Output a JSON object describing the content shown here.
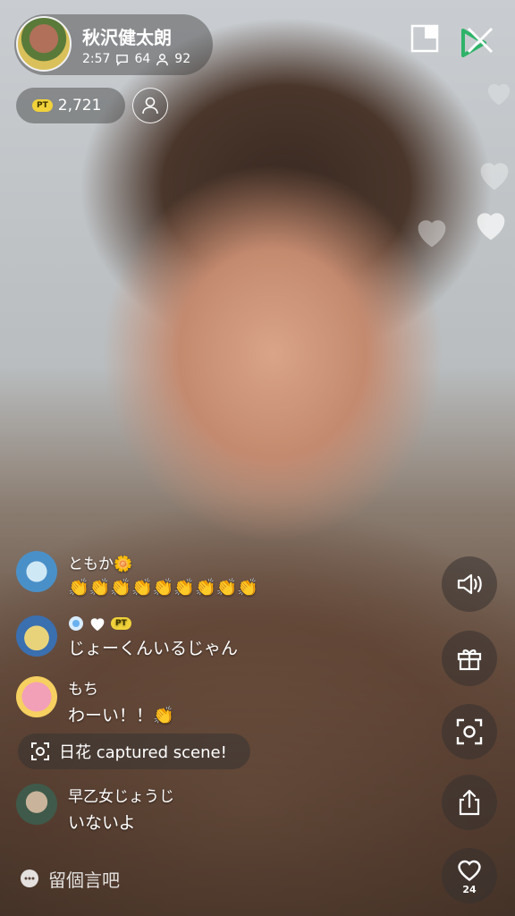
{
  "host": {
    "name": "秋沢健太朗",
    "time": "2:57",
    "comments": "64",
    "viewers": "92"
  },
  "points": {
    "badge": "PT",
    "value": "2,721"
  },
  "comments": [
    {
      "name": "ともか🌼",
      "text": "👏👏👏👏👏👏👏👏👏"
    },
    {
      "name": "",
      "badge": "PT",
      "text": "じょーくんいるじゃん"
    },
    {
      "name": "もち",
      "text": "わーい！！👏"
    },
    {
      "name": "早乙女じょうじ",
      "text": "いないよ"
    }
  ],
  "capture": {
    "text": "日花 captured scene!"
  },
  "input": {
    "placeholder": "留個言吧"
  },
  "like": {
    "count": "24"
  },
  "colors": {
    "accent": "#2fb36a",
    "pt_badge": "#f1d23a"
  }
}
